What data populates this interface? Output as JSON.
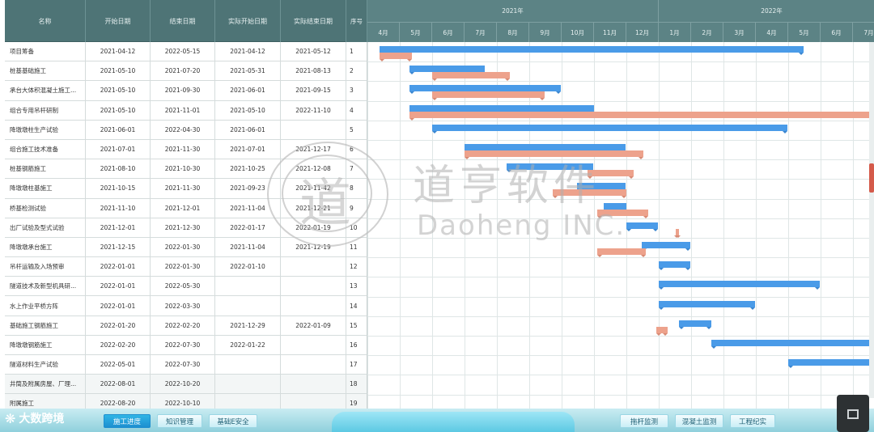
{
  "table": {
    "headers": [
      "名称",
      "开始日期",
      "结束日期",
      "实际开始日期",
      "实际结束日期"
    ],
    "index_header": "序号",
    "rows": [
      {
        "no": "1",
        "name": "项目筹备",
        "start": "2021-04-12",
        "end": "2022-05-15",
        "act_start": "2021-04-12",
        "act_end": "2021-05-12"
      },
      {
        "no": "2",
        "name": "桩基基础施工",
        "start": "2021-05-10",
        "end": "2021-07-20",
        "act_start": "2021-05-31",
        "act_end": "2021-08-13"
      },
      {
        "no": "3",
        "name": "承台大体积混凝土施工...",
        "start": "2021-05-10",
        "end": "2021-09-30",
        "act_start": "2021-06-01",
        "act_end": "2021-09-15"
      },
      {
        "no": "4",
        "name": "组合专用吊杆研制",
        "start": "2021-05-10",
        "end": "2021-11-01",
        "act_start": "2021-05-10",
        "act_end": "2022-11-10"
      },
      {
        "no": "5",
        "name": "降墩墩柱生产试验",
        "start": "2021-06-01",
        "end": "2022-04-30",
        "act_start": "2021-06-01",
        "act_end": ""
      },
      {
        "no": "6",
        "name": "组合施工技术准备",
        "start": "2021-07-01",
        "end": "2021-11-30",
        "act_start": "2021-07-01",
        "act_end": "2021-12-17"
      },
      {
        "no": "7",
        "name": "桩基钢筋施工",
        "start": "2021-08-10",
        "end": "2021-10-30",
        "act_start": "2021-10-25",
        "act_end": "2021-12-08"
      },
      {
        "no": "8",
        "name": "降墩墩柱基施工",
        "start": "2021-10-15",
        "end": "2021-11-30",
        "act_start": "2021-09-23",
        "act_end": "2021-11-42"
      },
      {
        "no": "9",
        "name": "桥基检测试验",
        "start": "2021-11-10",
        "end": "2021-12-01",
        "act_start": "2021-11-04",
        "act_end": "2021-12-21"
      },
      {
        "no": "10",
        "name": "出厂试验及型式试验",
        "start": "2021-12-01",
        "end": "2021-12-30",
        "act_start": "2022-01-17",
        "act_end": "2022-01-19"
      },
      {
        "no": "11",
        "name": "降墩墩承台施工",
        "start": "2021-12-15",
        "end": "2022-01-30",
        "act_start": "2021-11-04",
        "act_end": "2021-12-19"
      },
      {
        "no": "12",
        "name": "吊杆运输及入场预审",
        "start": "2022-01-01",
        "end": "2022-01-30",
        "act_start": "2022-01-10",
        "act_end": ""
      },
      {
        "no": "13",
        "name": "隧道技术及新型机具研...",
        "start": "2022-01-01",
        "end": "2022-05-30",
        "act_start": "",
        "act_end": ""
      },
      {
        "no": "14",
        "name": "水上作业平桥方阵",
        "start": "2022-01-01",
        "end": "2022-03-30",
        "act_start": "",
        "act_end": ""
      },
      {
        "no": "15",
        "name": "基础施工钢筋施工",
        "start": "2022-01-20",
        "end": "2022-02-20",
        "act_start": "2021-12-29",
        "act_end": "2022-01-09"
      },
      {
        "no": "16",
        "name": "降墩墩钢筋施工",
        "start": "2022-02-20",
        "end": "2022-07-30",
        "act_start": "2022-01-22",
        "act_end": ""
      },
      {
        "no": "17",
        "name": "隧道材料生产试验",
        "start": "2022-05-01",
        "end": "2022-07-30",
        "act_start": "",
        "act_end": ""
      },
      {
        "no": "18",
        "name": "井筒及附属房屋、厂理...",
        "start": "2022-08-01",
        "end": "2022-10-20",
        "act_start": "",
        "act_end": ""
      },
      {
        "no": "19",
        "name": "附属施工",
        "start": "2022-08-20",
        "end": "2022-10-10",
        "act_start": "",
        "act_end": ""
      }
    ]
  },
  "timeline": {
    "years": [
      "2021年",
      "2022年"
    ],
    "months": [
      "4月",
      "5月",
      "6月",
      "7月",
      "8月",
      "9月",
      "10月",
      "11月",
      "12月",
      "1月",
      "2月",
      "3月",
      "4月",
      "5月",
      "6月",
      "7月"
    ]
  },
  "watermark": {
    "glyph": "道",
    "cn": "道亨软件",
    "en": "Daoheng INC."
  },
  "nav": {
    "brand": "大数跨境",
    "left_buttons": [
      "施工进度",
      "知识管理",
      "基础E安全"
    ],
    "right_buttons": [
      "拖杆监测",
      "混凝土监测",
      "工程纪实"
    ],
    "active": "施工进度"
  },
  "colors": {
    "header_bg": "#4e7476",
    "plan_bar": "#4a9be8",
    "actual_bar": "#eda28c",
    "nav_active": "#1d8fd0"
  }
}
